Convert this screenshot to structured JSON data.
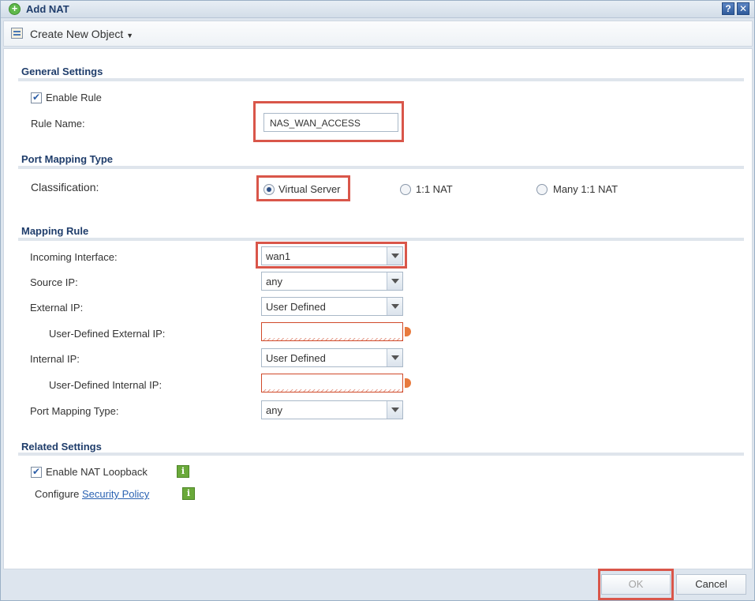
{
  "window": {
    "title": "Add NAT",
    "help_icon": "?",
    "close_icon": "✕"
  },
  "toolbar": {
    "create_new_object": "Create New Object"
  },
  "general_settings": {
    "title": "General Settings",
    "enable_rule_label": "Enable Rule",
    "enable_rule_checked": true,
    "rule_name_label": "Rule Name:",
    "rule_name_value": "NAS_WAN_ACCESS"
  },
  "port_mapping_type": {
    "title": "Port Mapping Type",
    "classification_label": "Classification:",
    "options": [
      "Virtual Server",
      "1:1 NAT",
      "Many 1:1 NAT"
    ],
    "selected": "Virtual Server"
  },
  "mapping_rule": {
    "title": "Mapping Rule",
    "incoming_interface_label": "Incoming Interface:",
    "incoming_interface_value": "wan1",
    "source_ip_label": "Source IP:",
    "source_ip_value": "any",
    "external_ip_label": "External IP:",
    "external_ip_value": "User Defined",
    "user_defined_external_ip_label": "User-Defined External IP:",
    "user_defined_external_ip_value": "",
    "internal_ip_label": "Internal IP:",
    "internal_ip_value": "User Defined",
    "user_defined_internal_ip_label": "User-Defined Internal IP:",
    "user_defined_internal_ip_value": "",
    "port_mapping_type_label": "Port Mapping Type:",
    "port_mapping_type_value": "any"
  },
  "related_settings": {
    "title": "Related Settings",
    "enable_nat_loopback_label": "Enable NAT Loopback",
    "enable_nat_loopback_checked": true,
    "configure_label": "Configure",
    "security_policy_link": "Security Policy",
    "info_icon": "i"
  },
  "footer": {
    "ok_label": "OK",
    "cancel_label": "Cancel"
  },
  "colors": {
    "highlight": "#d9564a",
    "section_title": "#1f3d6b",
    "link": "#2a62b2"
  }
}
